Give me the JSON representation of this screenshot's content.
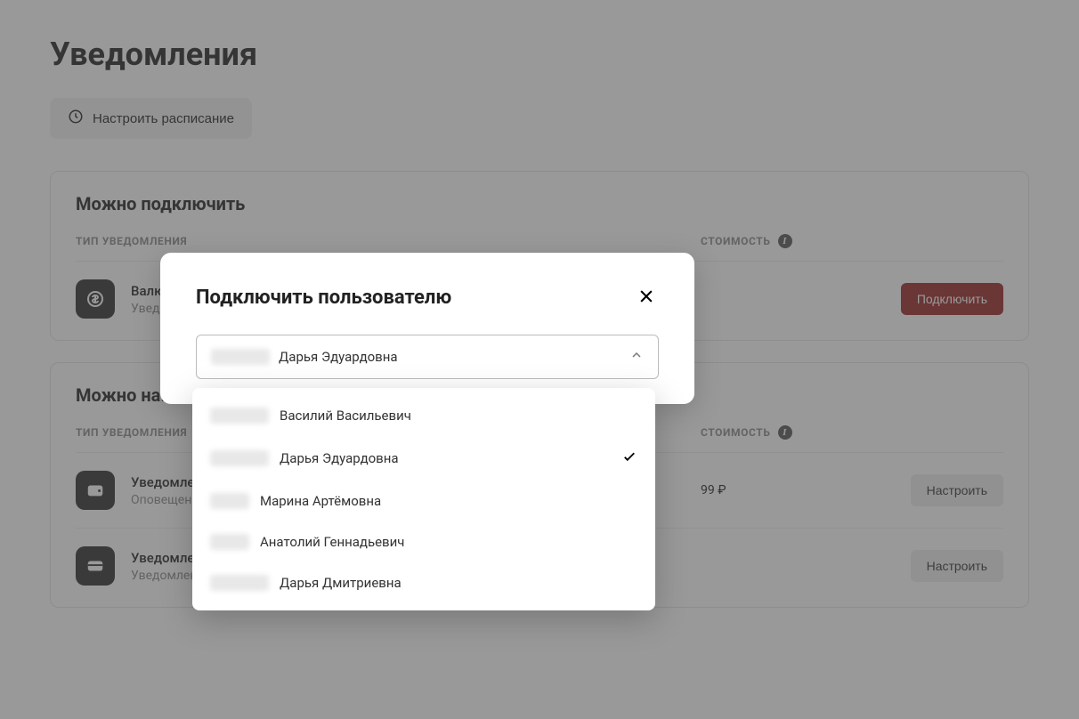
{
  "page": {
    "title": "Уведомления",
    "schedule_button": "Настроить расписание"
  },
  "columns": {
    "type": "ТИП УВЕДОМЛЕНИЯ",
    "cost": "СТОИМОСТЬ"
  },
  "section_available": {
    "title": "Можно подключить",
    "items": [
      {
        "title": "Валю…",
        "subtitle": "Увед…",
        "cost": "",
        "action": "Подключить"
      }
    ]
  },
  "section_configure": {
    "title": "Можно на…",
    "items": [
      {
        "title": "Уведомлен…",
        "subtitle": "Оповещени…",
        "cost": "99 ₽",
        "action": "Настроить"
      },
      {
        "title": "Уведомлен…",
        "subtitle": "Уведомления о покупках и снятии наличных по вашей карте",
        "cost": "",
        "action": "Настроить"
      }
    ]
  },
  "modal": {
    "title": "Подключить пользователю",
    "selected": "Дарья Эдуардовна",
    "options": [
      {
        "name": "Василий Васильевич",
        "selected": false
      },
      {
        "name": "Дарья Эдуардовна",
        "selected": true
      },
      {
        "name": "Марина Артёмовна",
        "selected": false
      },
      {
        "name": "Анатолий Геннадьевич",
        "selected": false
      },
      {
        "name": "Дарья Дмитриевна",
        "selected": false
      }
    ]
  }
}
